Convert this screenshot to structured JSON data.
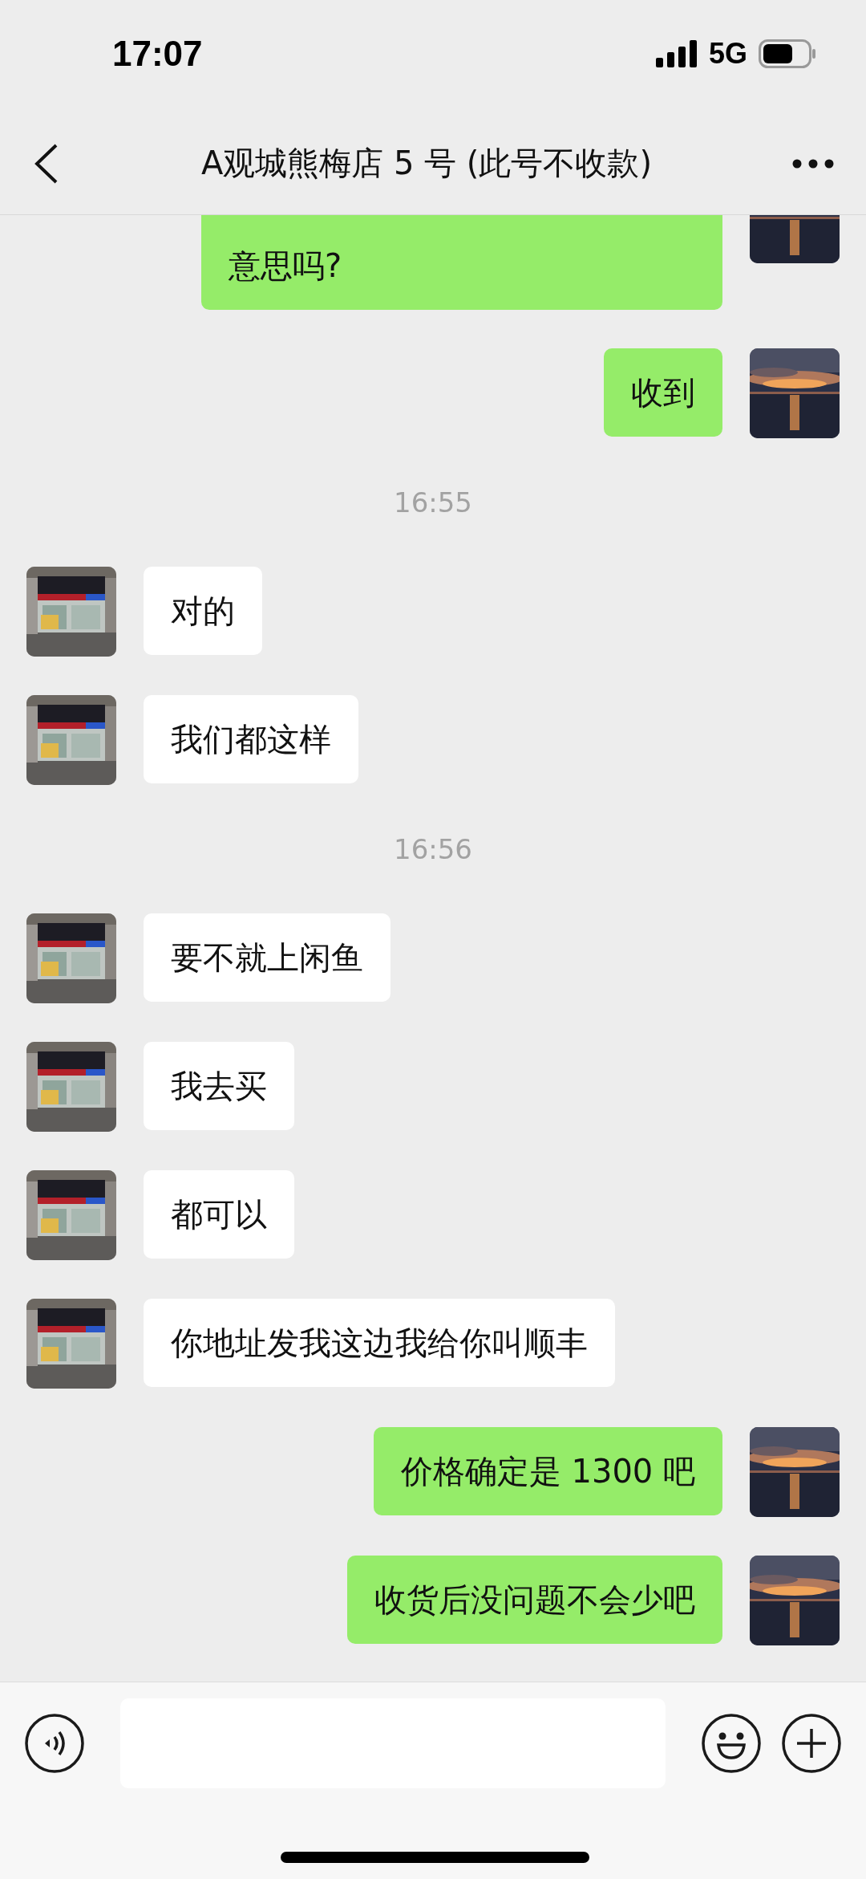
{
  "status_bar": {
    "time": "17:07",
    "network": "5G"
  },
  "header": {
    "title": "A观城熊梅店 5 号 (此号不收款)"
  },
  "messages": [
    {
      "kind": "out",
      "text": "意思吗?"
    },
    {
      "kind": "out",
      "text": "收到"
    },
    {
      "kind": "time",
      "text": "16:55"
    },
    {
      "kind": "in",
      "text": "对的"
    },
    {
      "kind": "in",
      "text": "我们都这样"
    },
    {
      "kind": "time",
      "text": "16:56"
    },
    {
      "kind": "in",
      "text": "要不就上闲鱼"
    },
    {
      "kind": "in",
      "text": "我去买"
    },
    {
      "kind": "in",
      "text": "都可以"
    },
    {
      "kind": "in",
      "text": "你地址发我这边我给你叫顺丰"
    },
    {
      "kind": "out",
      "text": "价格确定是 1300 吧"
    },
    {
      "kind": "out",
      "text": "收货后没问题不会少吧"
    }
  ]
}
